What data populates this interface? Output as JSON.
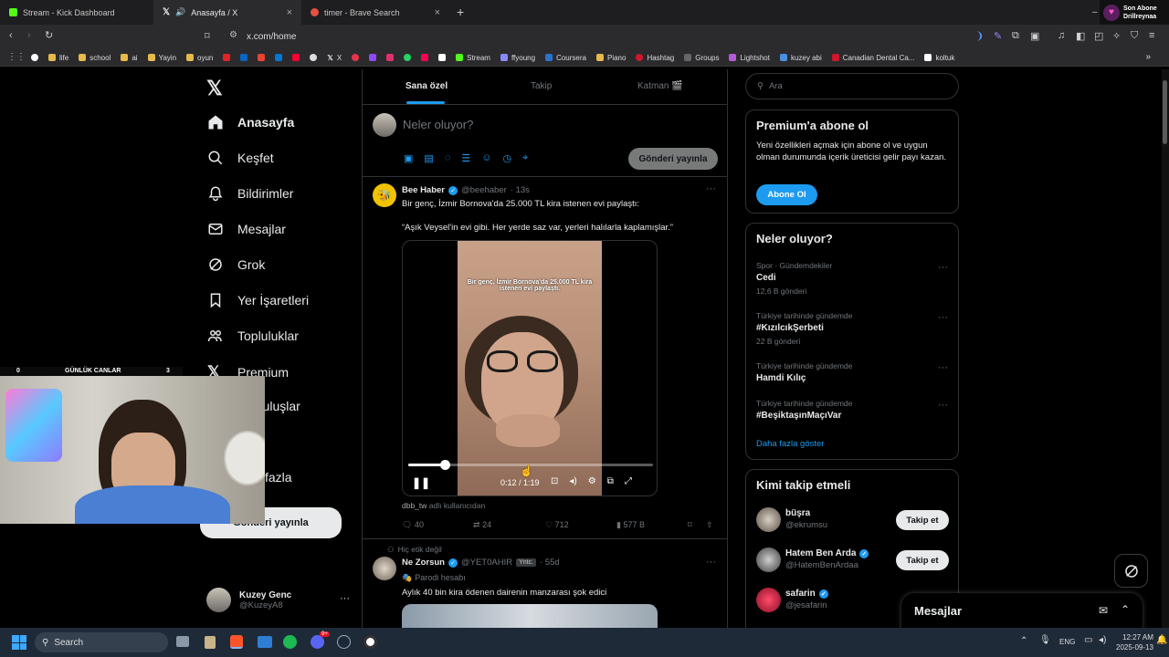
{
  "tabs": [
    {
      "title": "Stream - Kick Dashboard"
    },
    {
      "title": "Anasayfa / X"
    },
    {
      "title": "timer - Brave Search"
    }
  ],
  "new_tab": "+",
  "stream_notice": {
    "line1": "Son Abone",
    "line2": "Drillreynaa"
  },
  "url": "x.com/home",
  "bookmarks": [
    "life",
    "school",
    "ai",
    "Yayin",
    "oyun",
    "X",
    "Stream",
    "ffyoung",
    "Coursera",
    "Piano",
    "Hashtag",
    "Groups",
    "Lightshot",
    "kuzey abi",
    "Canadian Dental Ca...",
    "koltuk"
  ],
  "nav": {
    "home": "Anasayfa",
    "explore": "Keşfet",
    "notifications": "Bildirimler",
    "messages": "Mesajlar",
    "grok": "Grok",
    "bookmarks": "Yer İşaretleri",
    "communities": "Topluluklar",
    "premium": "Premium",
    "orgs": "ı Kuruluşlar",
    "more": "fazla",
    "post_button": "Gönderi yayınla"
  },
  "profile": {
    "name": "Kuzey Genc",
    "handle": "@KuzeyA8"
  },
  "webcam": {
    "left": "0",
    "center": "GÜNLÜK CANLAR",
    "right": "3"
  },
  "feed_tabs": [
    "Sana özel",
    "Takip",
    "Katman 🎬"
  ],
  "composer": {
    "placeholder": "Neler oluyor?",
    "button": "Gönderi yayınla"
  },
  "tweet1": {
    "name": "Bee Haber",
    "handle": "@beehaber",
    "time": "· 13s",
    "text1": "Bir genç, İzmir Bornova'da 25.000 TL kira istenen evi paylaştı:",
    "text2": "“Aşık Veysel'in evi gibi. Her yerde saz var, yerleri halılarla kaplamışlar.”",
    "video_caption": "Bir genç, İzmir Bornova'da 25.000 TL kira istenen evi paylaştı.",
    "video_time": "0:12 / 1:19",
    "video_progress": 0.15,
    "credit_user": "dbb_tw",
    "credit_text": "adlı kullanıcıdan",
    "replies": "40",
    "reposts": "24",
    "likes": "712",
    "views": "577 B"
  },
  "tweet2": {
    "context": "Hiç etik değil",
    "name": "Ne Zorsun",
    "handle": "@YET0AHIR",
    "badge": "Yntc.",
    "time": "· 55d",
    "parody": "Parodi hesabı",
    "text": "Aylık 40 bin kira ödenen dairenin manzarası şok edici"
  },
  "search": {
    "placeholder": "Ara"
  },
  "premium_box": {
    "title": "Premium'a abone ol",
    "text": "Yeni özellikleri açmak için abone ol ve uygun olman durumunda içerik üreticisi gelir payı kazan.",
    "button": "Abone Ol"
  },
  "trends": {
    "title": "Neler oluyor?",
    "items": [
      {
        "context": "Spor · Gündemdekiler",
        "name": "Cedi",
        "count": "12,6 B gönderi"
      },
      {
        "context": "Türkiye tarihinde gündemde",
        "name": "#KızılcıkŞerbeti",
        "count": "22 B gönderi"
      },
      {
        "context": "Türkiye tarihinde gündemde",
        "name": "Hamdi Kılıç",
        "count": ""
      },
      {
        "context": "Türkiye tarihinde gündemde",
        "name": "#BeşiktaşınMaçıVar",
        "count": ""
      }
    ],
    "more": "Daha fazla göster"
  },
  "who_to_follow": {
    "title": "Kimi takip etmeli",
    "items": [
      {
        "name": "büşra",
        "handle": "@ekrumsu",
        "button": "Takip et"
      },
      {
        "name": "Hatem Ben Arda",
        "handle": "@HatemBenArdaa",
        "button": "Takip et"
      },
      {
        "name": "safarin",
        "handle": "@jesafarin",
        "button": ""
      }
    ]
  },
  "messages_drawer": {
    "title": "Mesajlar"
  },
  "taskbar": {
    "search": "Search",
    "lang": "ENG",
    "time": "12:27 AM",
    "date": "2025-09-13",
    "badge": "9+"
  },
  "colors": {
    "accent": "#1d9bf0",
    "bg": "#000000",
    "border": "#2f3336",
    "muted": "#71767b"
  }
}
